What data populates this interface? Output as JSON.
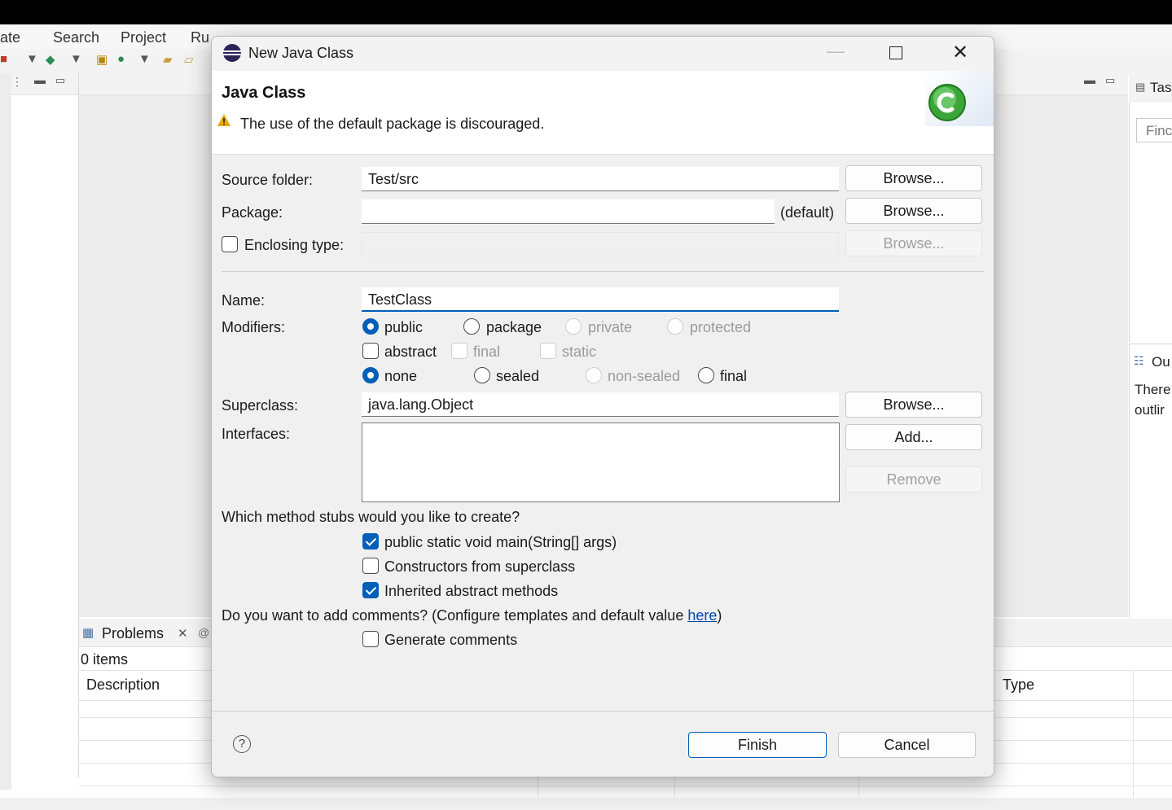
{
  "workbench": {
    "menu": [
      "ate",
      "Search",
      "Project",
      "Ru"
    ],
    "tasks_tab": "Tas",
    "tasks_find_placeholder": "Finc",
    "outline_tab": "Ou",
    "outline_message_1": "There",
    "outline_message_2": "outlir",
    "problems_tab": "Problems",
    "problems_count": "0 items",
    "col_description": "Description",
    "col_type": "Type"
  },
  "dialog": {
    "title": "New Java Class",
    "heading": "Java Class",
    "warning": "The use of the default package is discouraged.",
    "source_folder_label": "Source folder:",
    "source_folder_value": "Test/src",
    "package_label": "Package:",
    "package_value": "",
    "package_default": "(default)",
    "enclosing_label": "Enclosing type:",
    "browse": "Browse...",
    "name_label": "Name:",
    "name_value": "TestClass",
    "modifiers_label": "Modifiers:",
    "mod_public": "public",
    "mod_package": "package",
    "mod_private": "private",
    "mod_protected": "protected",
    "mod_abstract": "abstract",
    "mod_final": "final",
    "mod_static": "static",
    "mod_none": "none",
    "mod_sealed": "sealed",
    "mod_non_sealed": "non-sealed",
    "mod_final2": "final",
    "superclass_label": "Superclass:",
    "superclass_value": "java.lang.Object",
    "interfaces_label": "Interfaces:",
    "add": "Add...",
    "remove": "Remove",
    "stubs_question": "Which method stubs would you like to create?",
    "stub_main": "public static void main(String[] args)",
    "stub_constructors": "Constructors from superclass",
    "stub_inherited": "Inherited abstract methods",
    "comments_question_prefix": "Do you want to add comments? (Configure templates and default value ",
    "comments_link": "here",
    "comments_question_suffix": ")",
    "generate_comments": "Generate comments",
    "finish": "Finish",
    "cancel": "Cancel",
    "help_glyph": "?"
  },
  "state": {
    "access": "public",
    "abstract": false,
    "final": false,
    "static": false,
    "inheritance": "none",
    "stub_main": true,
    "stub_constructors": false,
    "stub_inherited": true,
    "generate_comments": false
  },
  "colors": {
    "accent": "#005fb8",
    "warning": "#e8a800",
    "class_icon": "#3aa63a"
  }
}
